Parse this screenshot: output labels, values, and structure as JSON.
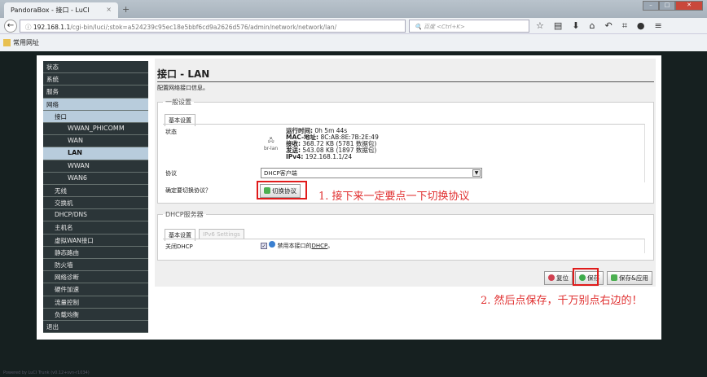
{
  "browser": {
    "tab_title": "PandoraBox - 接口 - LuCI",
    "url_host": "192.168.1.1",
    "url_path": "/cgi-bin/luci/;stok=a524239c95ec18e5bbf6cd9a2626d576/admin/network/network/lan/",
    "search_placeholder": "百度 <Ctrl+K>",
    "bookmark": "常用网址"
  },
  "sidebar": {
    "items": [
      {
        "label": "状态",
        "level": 1
      },
      {
        "label": "系统",
        "level": 1
      },
      {
        "label": "服务",
        "level": 1
      },
      {
        "label": "网络",
        "level": 1,
        "active": true
      },
      {
        "label": "接口",
        "level": 2,
        "active": true
      },
      {
        "label": "WWAN_PHICOMM",
        "level": 3
      },
      {
        "label": "WAN",
        "level": 3
      },
      {
        "label": "LAN",
        "level": 3,
        "active": true
      },
      {
        "label": "WWAN",
        "level": 3
      },
      {
        "label": "WAN6",
        "level": 3
      },
      {
        "label": "无线",
        "level": 2
      },
      {
        "label": "交换机",
        "level": 2
      },
      {
        "label": "DHCP/DNS",
        "level": 2
      },
      {
        "label": "主机名",
        "level": 2
      },
      {
        "label": "虚拟WAN接口",
        "level": 2
      },
      {
        "label": "静态路由",
        "level": 2
      },
      {
        "label": "防火墙",
        "level": 2
      },
      {
        "label": "网络诊断",
        "level": 2
      },
      {
        "label": "硬件加速",
        "level": 2
      },
      {
        "label": "流量控制",
        "level": 2
      },
      {
        "label": "负载均衡",
        "level": 2
      },
      {
        "label": "退出",
        "level": 1
      }
    ]
  },
  "main": {
    "title": "接口 - LAN",
    "description": "配置网络接口信息。",
    "general": {
      "legend": "一般设置",
      "tab": "基本设置",
      "status_label": "状态",
      "iface": "br-lan",
      "uptime_label": "运行时间:",
      "uptime": "0h 5m 44s",
      "mac_label": "MAC-地址:",
      "mac": "8C:AB:8E:7B:2E:49",
      "rx_label": "接收:",
      "rx": "368.72 KB (5781 数据包)",
      "tx_label": "发送:",
      "tx": "543.08 KB (1897 数据包)",
      "ipv4_label": "IPv4:",
      "ipv4": "192.168.1.1/24",
      "protocol_label": "协议",
      "protocol_value": "DHCP客户端",
      "switch_label": "确定要切换协议？",
      "switch_button": "切换协议"
    },
    "dhcp": {
      "legend": "DHCP服务器",
      "tab_basic": "基本设置",
      "tab_ipv6": "IPv6 Settings",
      "ignore_label": "关闭DHCP",
      "ignore_checked": true,
      "ignore_desc_prefix": "禁用本接口的",
      "ignore_desc_link": "DHCP",
      "ignore_desc_suffix": "。"
    },
    "buttons": {
      "reset": "复位",
      "save": "保存",
      "save_apply": "保存&应用"
    }
  },
  "annotations": {
    "step1": "1. 接下来一定要点一下切换协议",
    "step2": "2. 然后点保存，千万别点右边的！"
  },
  "footer": "Powered by LuCI Trunk (v0.12+svn-r1034)"
}
